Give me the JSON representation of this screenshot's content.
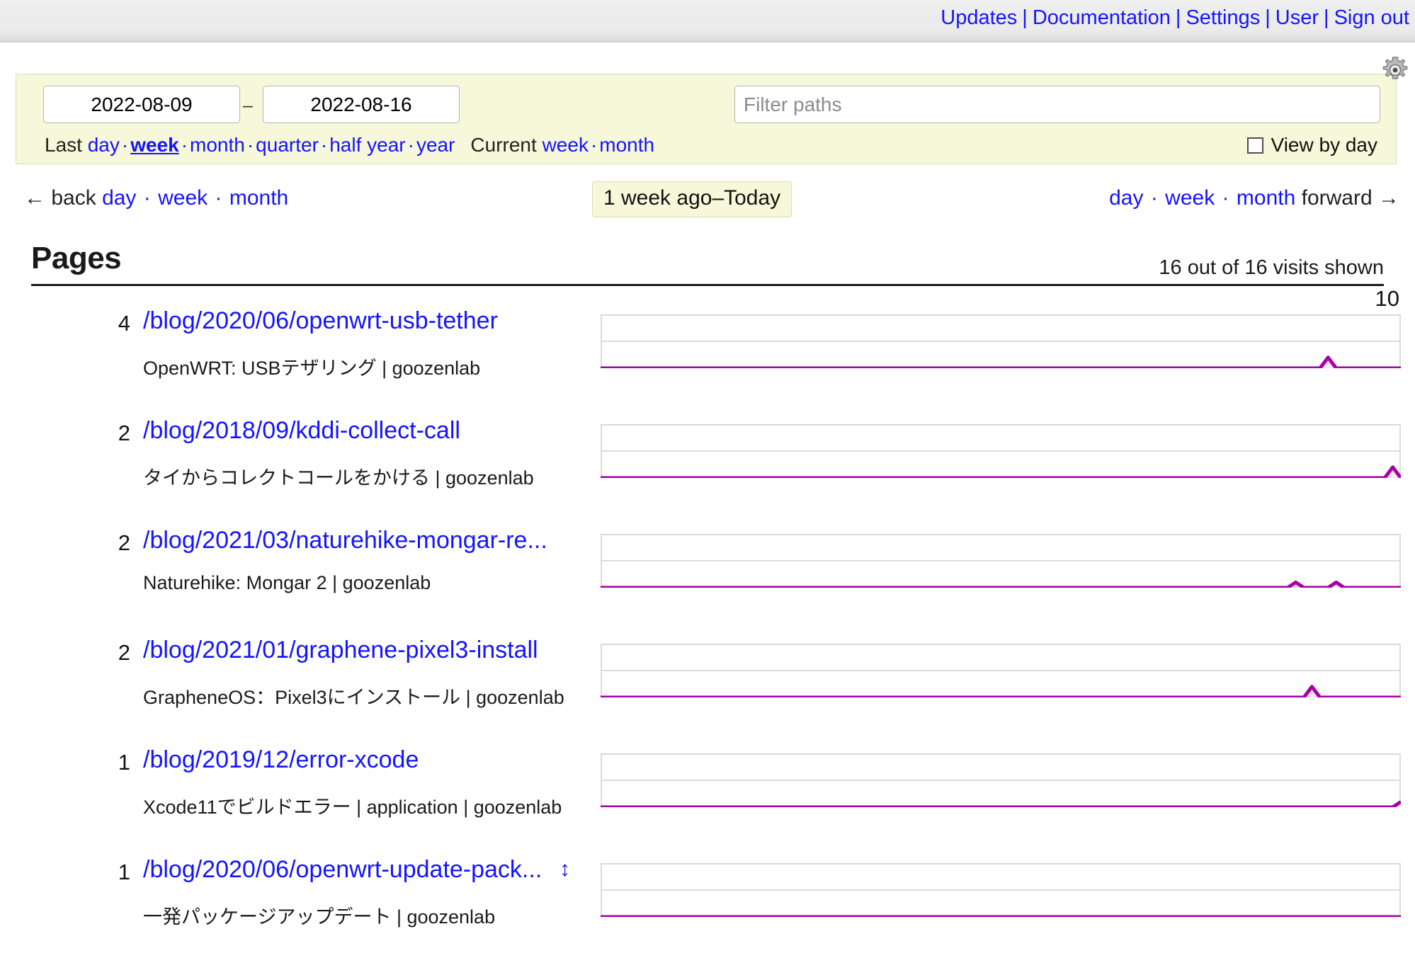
{
  "topnav": {
    "items": [
      {
        "label": "Updates",
        "name": "nav-updates"
      },
      {
        "label": "Documentation",
        "name": "nav-documentation"
      },
      {
        "label": "Settings",
        "name": "nav-settings"
      },
      {
        "label": "User",
        "name": "nav-user"
      },
      {
        "label": "Sign out",
        "name": "nav-sign-out"
      }
    ],
    "separator": "|"
  },
  "filter": {
    "date_from": "2022-08-09",
    "date_to": "2022-08-16",
    "date_separator": "–",
    "paths_placeholder": "Filter paths",
    "paths_value": "",
    "view_by_day_label": "View by day",
    "view_by_day_checked": false,
    "gear_icon": "gear-icon",
    "last_label": "Last",
    "last_options": [
      "day",
      "week",
      "month",
      "quarter",
      "half year",
      "year"
    ],
    "last_active": "week",
    "current_label": "Current",
    "current_options": [
      "week",
      "month"
    ],
    "separator": "·"
  },
  "nav": {
    "back_arrow": "←",
    "back_label": "back",
    "back_options": [
      "day",
      "week",
      "month"
    ],
    "range_badge": "1 week ago–Today",
    "forward_options": [
      "day",
      "week",
      "month"
    ],
    "forward_label": "forward",
    "forward_arrow": "→",
    "separator": "·"
  },
  "section": {
    "title": "Pages",
    "visits_shown": "16 out of 16 visits shown"
  },
  "chart_data": {
    "type": "line",
    "title": "Pages — visits sparklines",
    "ylabel": "",
    "xlabel": "",
    "ylim": [
      0,
      10
    ],
    "axis_max_label": "10",
    "gridlines": [
      10,
      5,
      0
    ],
    "line_color": "#a600a6",
    "fill_color": "#f7e6f7",
    "series": [
      {
        "name": "/blog/2020/06/openwrt-usb-tether",
        "values": [
          0,
          0,
          0,
          0,
          0,
          0,
          0,
          0,
          0,
          0,
          0,
          0,
          0,
          0,
          0,
          0,
          0,
          0,
          0,
          0,
          0,
          0,
          0,
          0,
          0,
          0,
          0,
          0,
          0,
          0,
          0,
          0,
          0,
          0,
          0,
          0,
          0,
          0,
          0,
          0,
          0,
          0,
          0,
          0,
          0,
          0,
          0,
          0,
          0,
          0,
          0,
          0,
          0,
          0,
          0,
          0,
          0,
          0,
          0,
          0,
          0,
          0,
          0,
          0,
          0,
          0,
          0,
          0,
          0,
          0,
          0,
          0,
          0,
          0,
          0,
          0,
          0,
          0,
          0,
          0,
          0,
          0,
          0,
          0,
          0,
          0,
          0,
          0,
          0,
          0,
          2,
          0,
          0,
          0,
          0,
          0,
          0,
          0,
          0,
          0
        ]
      },
      {
        "name": "/blog/2018/09/kddi-collect-call",
        "values": [
          0,
          0,
          0,
          0,
          0,
          0,
          0,
          0,
          0,
          0,
          0,
          0,
          0,
          0,
          0,
          0,
          0,
          0,
          0,
          0,
          0,
          0,
          0,
          0,
          0,
          0,
          0,
          0,
          0,
          0,
          0,
          0,
          0,
          0,
          0,
          0,
          0,
          0,
          0,
          0,
          0,
          0,
          0,
          0,
          0,
          0,
          0,
          0,
          0,
          0,
          0,
          0,
          0,
          0,
          0,
          0,
          0,
          0,
          0,
          0,
          0,
          0,
          0,
          0,
          0,
          0,
          0,
          0,
          0,
          0,
          0,
          0,
          0,
          0,
          0,
          0,
          0,
          0,
          0,
          0,
          0,
          0,
          0,
          0,
          0,
          0,
          0,
          0,
          0,
          0,
          0,
          0,
          0,
          0,
          0,
          0,
          0,
          0,
          2,
          0
        ]
      },
      {
        "name": "/blog/2021/03/naturehike-mongar-re...",
        "values": [
          0,
          0,
          0,
          0,
          0,
          0,
          0,
          0,
          0,
          0,
          0,
          0,
          0,
          0,
          0,
          0,
          0,
          0,
          0,
          0,
          0,
          0,
          0,
          0,
          0,
          0,
          0,
          0,
          0,
          0,
          0,
          0,
          0,
          0,
          0,
          0,
          0,
          0,
          0,
          0,
          0,
          0,
          0,
          0,
          0,
          0,
          0,
          0,
          0,
          0,
          0,
          0,
          0,
          0,
          0,
          0,
          0,
          0,
          0,
          0,
          0,
          0,
          0,
          0,
          0,
          0,
          0,
          0,
          0,
          0,
          0,
          0,
          0,
          0,
          0,
          0,
          0,
          0,
          0,
          0,
          0,
          0,
          0,
          0,
          0,
          0,
          1,
          0,
          0,
          0,
          0,
          1,
          0,
          0,
          0,
          0,
          0,
          0,
          0,
          0
        ]
      },
      {
        "name": "/blog/2021/01/graphene-pixel3-install",
        "values": [
          0,
          0,
          0,
          0,
          0,
          0,
          0,
          0,
          0,
          0,
          0,
          0,
          0,
          0,
          0,
          0,
          0,
          0,
          0,
          0,
          0,
          0,
          0,
          0,
          0,
          0,
          0,
          0,
          0,
          0,
          0,
          0,
          0,
          0,
          0,
          0,
          0,
          0,
          0,
          0,
          0,
          0,
          0,
          0,
          0,
          0,
          0,
          0,
          0,
          0,
          0,
          0,
          0,
          0,
          0,
          0,
          0,
          0,
          0,
          0,
          0,
          0,
          0,
          0,
          0,
          0,
          0,
          0,
          0,
          0,
          0,
          0,
          0,
          0,
          0,
          0,
          0,
          0,
          0,
          0,
          0,
          0,
          0,
          0,
          0,
          0,
          0,
          0,
          2,
          0,
          0,
          0,
          0,
          0,
          0,
          0,
          0,
          0,
          0,
          0
        ]
      },
      {
        "name": "/blog/2019/12/error-xcode",
        "values": [
          0,
          0,
          0,
          0,
          0,
          0,
          0,
          0,
          0,
          0,
          0,
          0,
          0,
          0,
          0,
          0,
          0,
          0,
          0,
          0,
          0,
          0,
          0,
          0,
          0,
          0,
          0,
          0,
          0,
          0,
          0,
          0,
          0,
          0,
          0,
          0,
          0,
          0,
          0,
          0,
          0,
          0,
          0,
          0,
          0,
          0,
          0,
          0,
          0,
          0,
          0,
          0,
          0,
          0,
          0,
          0,
          0,
          0,
          0,
          0,
          0,
          0,
          0,
          0,
          0,
          0,
          0,
          0,
          0,
          0,
          0,
          0,
          0,
          0,
          0,
          0,
          0,
          0,
          0,
          0,
          0,
          0,
          0,
          0,
          0,
          0,
          0,
          0,
          0,
          0,
          0,
          0,
          0,
          0,
          0,
          0,
          0,
          0,
          0,
          1
        ]
      },
      {
        "name": "/blog/2020/06/openwrt-update-pack...",
        "values": [
          0,
          0,
          0,
          0,
          0,
          0,
          0,
          0,
          0,
          0,
          0,
          0,
          0,
          0,
          0,
          0,
          0,
          0,
          0,
          0,
          0,
          0,
          0,
          0,
          0,
          0,
          0,
          0,
          0,
          0,
          0,
          0,
          0,
          0,
          0,
          0,
          0,
          0,
          0,
          0,
          0,
          0,
          0,
          0,
          0,
          0,
          0,
          0,
          0,
          0,
          0,
          0,
          0,
          0,
          0,
          0,
          0,
          0,
          0,
          0,
          0,
          0,
          0,
          0,
          0,
          0,
          0,
          0,
          0,
          0,
          0,
          0,
          0,
          0,
          0,
          0,
          0,
          0,
          0,
          0,
          0,
          0,
          0,
          0,
          0,
          0,
          0,
          0,
          0,
          0,
          0,
          0,
          0,
          0,
          0,
          0,
          0,
          0,
          0,
          0
        ]
      }
    ]
  },
  "rows": [
    {
      "count": "4",
      "path": "/blog/2020/06/openwrt-usb-tether",
      "title": "OpenWRT: USBテザリング | goozenlab",
      "axis_label": "10",
      "expand": ""
    },
    {
      "count": "2",
      "path": "/blog/2018/09/kddi-collect-call",
      "title": "タイからコレクトコールをかける | goozenlab",
      "axis_label": "",
      "expand": ""
    },
    {
      "count": "2",
      "path": "/blog/2021/03/naturehike-mongar-re...",
      "title": "Naturehike: Mongar 2 | goozenlab",
      "axis_label": "",
      "expand": ""
    },
    {
      "count": "2",
      "path": "/blog/2021/01/graphene-pixel3-install",
      "title": "GrapheneOS：Pixel3にインストール | goozenlab",
      "axis_label": "",
      "expand": ""
    },
    {
      "count": "1",
      "path": "/blog/2019/12/error-xcode",
      "title": "Xcode11でビルドエラー | application | goozenlab",
      "axis_label": "",
      "expand": ""
    },
    {
      "count": "1",
      "path": "/blog/2020/06/openwrt-update-pack...",
      "title": "一発パッケージアップデート | goozenlab",
      "axis_label": "",
      "expand": "↕"
    }
  ]
}
